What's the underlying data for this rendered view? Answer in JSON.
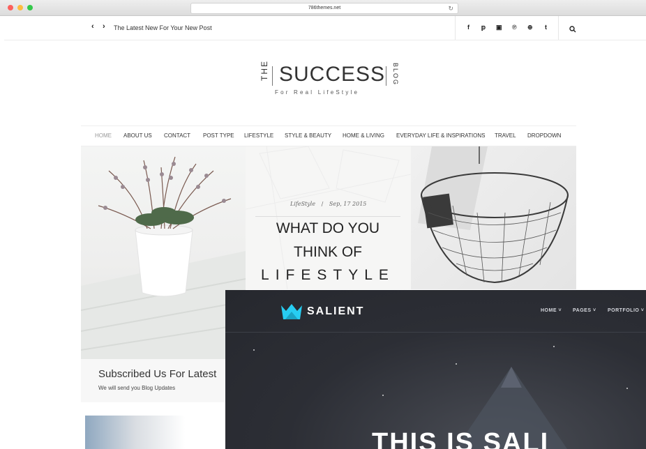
{
  "browser": {
    "url": "786themes.net",
    "dot_colors": [
      "#fc605c",
      "#fdbc40",
      "#34c84a"
    ]
  },
  "topbar": {
    "ticker": "The Latest New For Your New Post",
    "social_icons": [
      "facebook-icon",
      "twitter-icon",
      "instagram-icon",
      "pinterest-icon",
      "dribbble-icon",
      "tumblr-icon"
    ]
  },
  "logo": {
    "the": "THE",
    "main": "SUCCESS",
    "blog": "BLOG",
    "tagline": "For Real LifeStyle"
  },
  "menu": {
    "items": [
      "HOME",
      "ABOUT US",
      "CONTACT",
      "POST TYPE",
      "LIFESTYLE",
      "STYLE & BEAUTY",
      "HOME & LIVING",
      "EVERYDAY LIFE & INSPIRATIONS",
      "TRAVEL",
      "DROPDOWN"
    ],
    "active_color": "#999999"
  },
  "featured_post": {
    "category": "LifeStyle",
    "separator": "/",
    "date": "Sep, 17 2015",
    "title_line1": "WHAT DO YOU",
    "title_line2": "THINK OF",
    "title_line3": "LIFESTYLE"
  },
  "subscribe": {
    "title": "Subscribed Us For Latest",
    "description": "We will send you Blog Updates"
  },
  "salient": {
    "brand": "SALIENT",
    "nav": [
      "HOME",
      "PAGES",
      "PORTFOLIO"
    ],
    "hero": "THIS IS SALI",
    "brand_color": "#27cdf2"
  }
}
